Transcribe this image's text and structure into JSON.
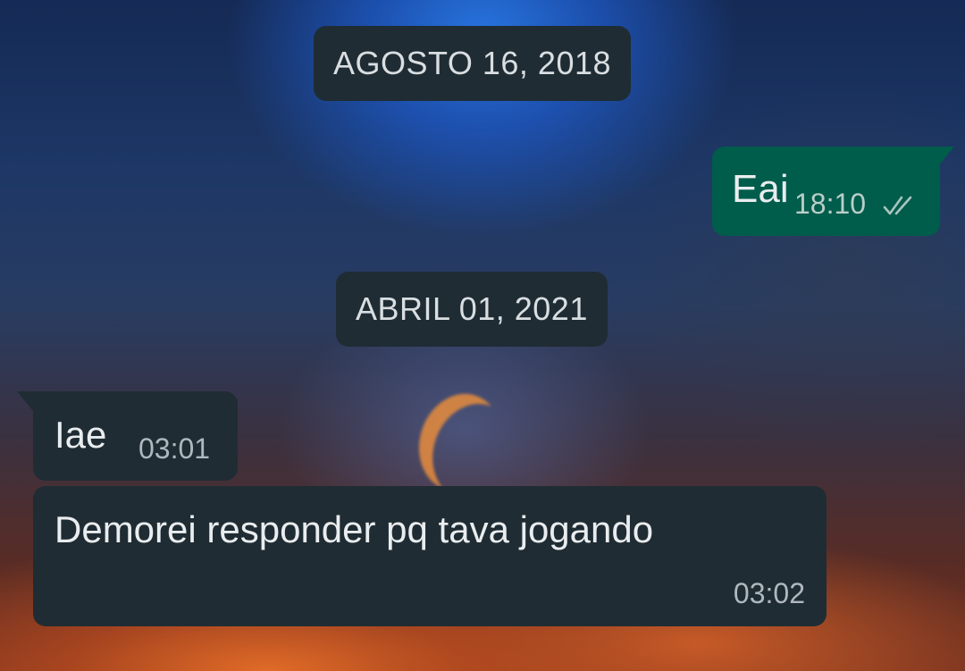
{
  "chat": {
    "date_separators": [
      {
        "label": "AGOSTO 16, 2018"
      },
      {
        "label": "ABRIL 01, 2021"
      }
    ],
    "messages": [
      {
        "direction": "outgoing",
        "text": "Eai",
        "time": "18:10",
        "status_icon": "double-check-icon"
      },
      {
        "direction": "incoming",
        "text": "Iae",
        "time": "03:01"
      },
      {
        "direction": "incoming",
        "text": "Demorei responder pq tava jogando",
        "time": "03:02"
      }
    ]
  },
  "colors": {
    "outgoing_bubble": "#005c4b",
    "incoming_bubble": "#202c33",
    "date_chip": "#1f2c34",
    "text": "#e9edef"
  }
}
